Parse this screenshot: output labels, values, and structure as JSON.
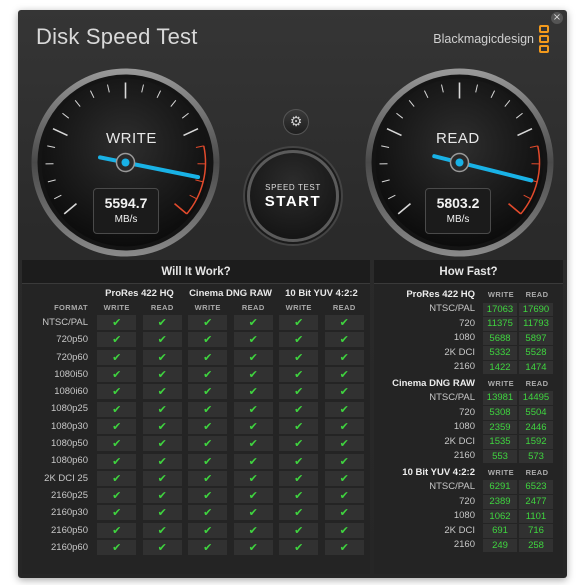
{
  "app": {
    "title": "Disk Speed Test",
    "brand": "Blackmagicdesign",
    "close_icon": "×"
  },
  "colors": {
    "needle": "#19b2e6",
    "redline": "#e24a2c",
    "check": "#3fd53f",
    "brand_orange": "#f39a1c"
  },
  "gauges": {
    "write": {
      "label": "WRITE",
      "value": "5594.7",
      "unit": "MB/s",
      "needle_fraction": 0.89
    },
    "read": {
      "label": "READ",
      "value": "5803.2",
      "unit": "MB/s",
      "needle_fraction": 0.9
    }
  },
  "settings_icon": "gear-icon",
  "start_button": {
    "small": "SPEED TEST",
    "big": "START"
  },
  "will_it_work": {
    "title": "Will It Work?",
    "format_header": "FORMAT",
    "groups": [
      "ProRes 422 HQ",
      "Cinema DNG RAW",
      "10 Bit YUV 4:2:2"
    ],
    "subheaders": [
      "WRITE",
      "READ"
    ],
    "check_glyph": "✔",
    "rows": [
      "NTSC/PAL",
      "720p50",
      "720p60",
      "1080i50",
      "1080i60",
      "1080p25",
      "1080p30",
      "1080p50",
      "1080p60",
      "2K DCI 25",
      "2160p25",
      "2160p30",
      "2160p50",
      "2160p60"
    ]
  },
  "how_fast": {
    "title": "How Fast?",
    "col_headers": [
      "WRITE",
      "READ"
    ],
    "groups": [
      {
        "name": "ProRes 422 HQ",
        "rows": [
          {
            "label": "NTSC/PAL",
            "write": "17063",
            "read": "17690"
          },
          {
            "label": "720",
            "write": "11375",
            "read": "11793"
          },
          {
            "label": "1080",
            "write": "5688",
            "read": "5897"
          },
          {
            "label": "2K DCI",
            "write": "5332",
            "read": "5528"
          },
          {
            "label": "2160",
            "write": "1422",
            "read": "1474"
          }
        ]
      },
      {
        "name": "Cinema DNG RAW",
        "rows": [
          {
            "label": "NTSC/PAL",
            "write": "13981",
            "read": "14495"
          },
          {
            "label": "720",
            "write": "5308",
            "read": "5504"
          },
          {
            "label": "1080",
            "write": "2359",
            "read": "2446"
          },
          {
            "label": "2K DCI",
            "write": "1535",
            "read": "1592"
          },
          {
            "label": "2160",
            "write": "553",
            "read": "573"
          }
        ]
      },
      {
        "name": "10 Bit YUV 4:2:2",
        "rows": [
          {
            "label": "NTSC/PAL",
            "write": "6291",
            "read": "6523"
          },
          {
            "label": "720",
            "write": "2389",
            "read": "2477"
          },
          {
            "label": "1080",
            "write": "1062",
            "read": "1101"
          },
          {
            "label": "2K DCI",
            "write": "691",
            "read": "716"
          },
          {
            "label": "2160",
            "write": "249",
            "read": "258"
          }
        ]
      }
    ]
  }
}
